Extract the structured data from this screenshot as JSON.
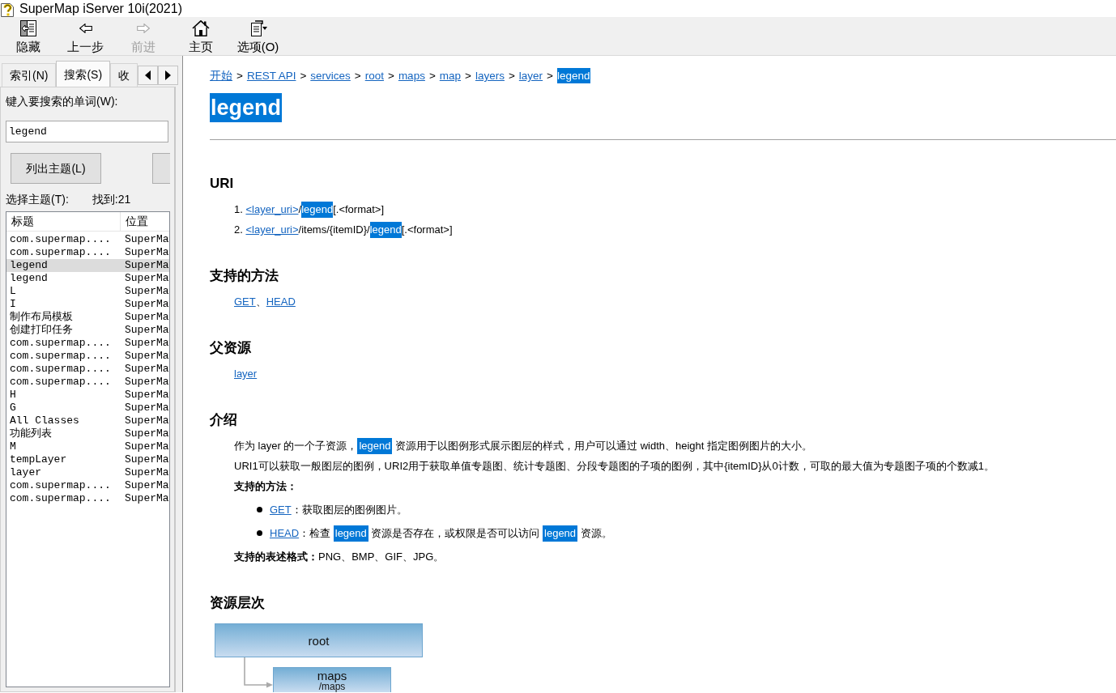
{
  "window": {
    "title": "SuperMap iServer 10i(2021)"
  },
  "toolbar": [
    {
      "label": "隐藏",
      "kind": "hide",
      "disabled": false
    },
    {
      "label": "上一步",
      "kind": "back",
      "disabled": false
    },
    {
      "label": "前进",
      "kind": "forward",
      "disabled": true
    },
    {
      "label": "主页",
      "kind": "home",
      "disabled": false
    },
    {
      "label": "选项(O)",
      "kind": "options",
      "disabled": false
    }
  ],
  "nav_pane": {
    "tabs": [
      {
        "label": "索引(N)",
        "selected": false
      },
      {
        "label": "搜索(S)",
        "selected": true
      },
      {
        "label": "收",
        "selected": false
      }
    ],
    "search_label": "键入要搜索的单词(W):",
    "search": {
      "value": "legend"
    },
    "list_button": "列出主题(L)",
    "topics_label": "选择主题(T):",
    "found": "找到:21",
    "results": {
      "columns": [
        "标题",
        "位置"
      ],
      "rows": [
        {
          "cells": [
            "com.supermap....",
            "SuperMa"
          ],
          "selected": false
        },
        {
          "cells": [
            "com.supermap....",
            "SuperMa"
          ],
          "selected": false
        },
        {
          "cells": [
            "legend",
            "SuperMa"
          ],
          "selected": true
        },
        {
          "cells": [
            "legend",
            "SuperMa"
          ],
          "selected": false
        },
        {
          "cells": [
            "L",
            "SuperMa"
          ],
          "selected": false
        },
        {
          "cells": [
            "I",
            "SuperMa"
          ],
          "selected": false
        },
        {
          "cells": [
            "制作布局模板",
            "SuperMa"
          ],
          "selected": false
        },
        {
          "cells": [
            "创建打印任务",
            "SuperMa"
          ],
          "selected": false
        },
        {
          "cells": [
            "com.supermap....",
            "SuperMa"
          ],
          "selected": false
        },
        {
          "cells": [
            "com.supermap....",
            "SuperMa"
          ],
          "selected": false
        },
        {
          "cells": [
            "com.supermap....",
            "SuperMa"
          ],
          "selected": false
        },
        {
          "cells": [
            "com.supermap....",
            "SuperMa"
          ],
          "selected": false
        },
        {
          "cells": [
            "H",
            "SuperMa"
          ],
          "selected": false
        },
        {
          "cells": [
            "G",
            "SuperMa"
          ],
          "selected": false
        },
        {
          "cells": [
            "All Classes",
            "SuperMa"
          ],
          "selected": false
        },
        {
          "cells": [
            "功能列表",
            "SuperMa"
          ],
          "selected": false
        },
        {
          "cells": [
            "M",
            "SuperMa"
          ],
          "selected": false
        },
        {
          "cells": [
            "tempLayer",
            "SuperMa"
          ],
          "selected": false
        },
        {
          "cells": [
            "layer",
            "SuperMa"
          ],
          "selected": false
        },
        {
          "cells": [
            "com.supermap....",
            "SuperMa"
          ],
          "selected": false
        },
        {
          "cells": [
            "com.supermap....",
            "SuperMa"
          ],
          "selected": false
        }
      ]
    }
  },
  "content": {
    "breadcrumb": [
      {
        "text": "开始",
        "kind": "link"
      },
      {
        "text": ">",
        "kind": "separator"
      },
      {
        "text": "REST API",
        "kind": "link"
      },
      {
        "text": ">",
        "kind": "separator"
      },
      {
        "text": "services",
        "kind": "link"
      },
      {
        "text": ">",
        "kind": "separator"
      },
      {
        "text": "root",
        "kind": "link"
      },
      {
        "text": ">",
        "kind": "separator"
      },
      {
        "text": "maps",
        "kind": "link"
      },
      {
        "text": ">",
        "kind": "separator"
      },
      {
        "text": "map",
        "kind": "link"
      },
      {
        "text": ">",
        "kind": "separator"
      },
      {
        "text": "layers",
        "kind": "link"
      },
      {
        "text": ">",
        "kind": "separator"
      },
      {
        "text": "layer",
        "kind": "link"
      },
      {
        "text": ">",
        "kind": "separator"
      },
      {
        "text": "legend",
        "kind": "highlight"
      }
    ],
    "title": {
      "text": "legend",
      "highlighted": true
    },
    "sections": [
      {
        "heading": "URI",
        "blocks": [
          {
            "kind": "numbered",
            "number": "1.",
            "parts": [
              {
                "text": "<layer_uri>",
                "kind": "link"
              },
              {
                "text": "/",
                "kind": "text"
              },
              {
                "text": "legend",
                "kind": "highlight"
              },
              {
                "text": "[.<format>]",
                "kind": "text"
              }
            ]
          },
          {
            "kind": "numbered",
            "number": "2.",
            "parts": [
              {
                "text": "<layer_uri>",
                "kind": "link"
              },
              {
                "text": "/items/{itemID}/",
                "kind": "text"
              },
              {
                "text": "legend",
                "kind": "highlight"
              },
              {
                "text": "[.<format>]",
                "kind": "text"
              }
            ]
          }
        ]
      },
      {
        "heading": "支持的方法",
        "blocks": [
          {
            "kind": "line",
            "parts": [
              {
                "text": "GET",
                "kind": "link"
              },
              {
                "text": "、",
                "kind": "text"
              },
              {
                "text": "HEAD",
                "kind": "link"
              }
            ]
          }
        ]
      },
      {
        "heading": "父资源",
        "blocks": [
          {
            "kind": "line",
            "parts": [
              {
                "text": "layer",
                "kind": "link"
              }
            ]
          }
        ]
      },
      {
        "heading": "介绍",
        "blocks": [
          {
            "kind": "line",
            "parts": [
              {
                "text": "作为 layer 的一个子资源，",
                "kind": "text"
              },
              {
                "text": "legend",
                "kind": "highlight"
              },
              {
                "text": " 资源用于以图例形式展示图层的样式，用户可以通过 width、height 指定图例图片的大小。",
                "kind": "text"
              }
            ]
          },
          {
            "kind": "line",
            "parts": [
              {
                "text": "URI1可以获取一般图层的图例，URI2用于获取单值专题图、统计专题图、分段专题图的子项的图例，其中{itemID}从0计数，可取的最大值为专题图子项的个数减1。",
                "kind": "text"
              }
            ]
          },
          {
            "kind": "label",
            "parts": [
              {
                "text": "支持的方法：",
                "kind": "text"
              }
            ]
          },
          {
            "kind": "bullet",
            "parts": [
              {
                "text": "GET",
                "kind": "link"
              },
              {
                "text": "：获取图层的图例图片。",
                "kind": "text"
              }
            ]
          },
          {
            "kind": "bullet",
            "parts": [
              {
                "text": "HEAD",
                "kind": "link"
              },
              {
                "text": "：检查 ",
                "kind": "text"
              },
              {
                "text": "legend",
                "kind": "highlight"
              },
              {
                "text": " 资源是否存在，或权限是否可以访问 ",
                "kind": "text"
              },
              {
                "text": "legend",
                "kind": "highlight"
              },
              {
                "text": " 资源。",
                "kind": "text"
              }
            ]
          },
          {
            "kind": "line",
            "parts": [
              {
                "text": "支持的表述格式：",
                "kind": "bold"
              },
              {
                "text": "PNG、BMP、GIF、JPG。",
                "kind": "text"
              }
            ]
          }
        ]
      },
      {
        "heading": "资源层次",
        "hierarchy": [
          {
            "label": "root",
            "children": [
              {
                "label": "maps",
                "path": "/maps"
              }
            ]
          }
        ]
      }
    ]
  }
}
